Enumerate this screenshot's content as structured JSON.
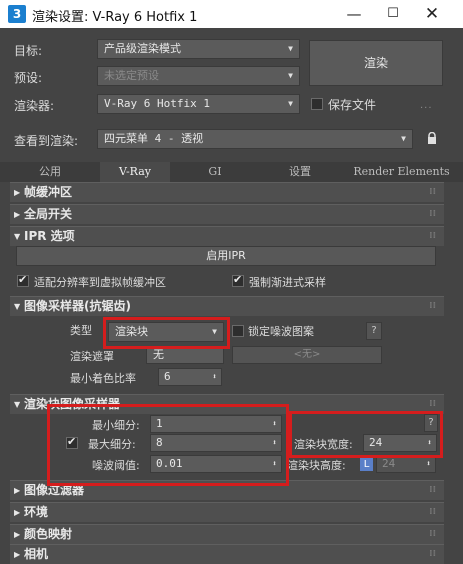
{
  "window": {
    "title": "渲染设置: V-Ray 6 Hotfix 1",
    "icon_text": "3",
    "minimize_icon": "minimize-icon",
    "maximize_icon": "maximize-icon",
    "close_icon": "close-icon"
  },
  "header": {
    "target_label": "目标:",
    "target_value": "产品级渲染模式",
    "preset_label": "预设:",
    "preset_value": "未选定预设",
    "renderer_label": "渲染器:",
    "renderer_value": "V-Ray 6 Hotfix 1",
    "save_file_label": "保存文件",
    "save_file_checked": false,
    "dots": "...",
    "view_label": "查看到渲染:",
    "view_value": "四元菜单 4 - 透视",
    "render_button": "渲染"
  },
  "tabs": [
    {
      "label": "公用",
      "active": false
    },
    {
      "label": "V-Ray",
      "active": true
    },
    {
      "label": "GI",
      "active": false
    },
    {
      "label": "设置",
      "active": false
    },
    {
      "label": "Render Elements",
      "active": false
    }
  ],
  "rollouts": {
    "frame_buffer": "帧缓冲区",
    "global_switches": "全局开关",
    "ipr_options": "IPR 选项",
    "image_sampler": "图像采样器(抗锯齿)",
    "bucket_sampler": "渲染块图像采样器",
    "image_filter": "图像过滤器",
    "environment": "环境",
    "color_mapping": "颜色映射",
    "camera": "相机",
    "grip": "⁞⁞"
  },
  "ipr": {
    "start_button": "启用IPR",
    "fit_resolution_label": "适配分辨率到虚拟帧缓冲区",
    "fit_resolution_checked": true,
    "force_progressive_label": "强制渐进式采样",
    "force_progressive_checked": true
  },
  "image_sampler": {
    "type_label": "类型",
    "type_value": "渲染块",
    "lock_noise_label": "锁定噪波图案",
    "lock_noise_checked": false,
    "help_button": "?",
    "render_mask_label": "渲染遮罩",
    "render_mask_value": "无",
    "render_mask_none": "<无>",
    "min_shading_label": "最小着色比率",
    "min_shading_value": "6"
  },
  "bucket_sampler": {
    "min_subdivs_label": "最小细分:",
    "min_subdivs_value": "1",
    "max_subdivs_label": "最大细分:",
    "max_subdivs_value": "8",
    "max_subdivs_checked": true,
    "noise_threshold_label": "噪波阈值:",
    "noise_threshold_value": "0.01",
    "help_button": "?",
    "bucket_width_label": "渲染块宽度:",
    "bucket_width_value": "24",
    "bucket_height_label": "渲染块高度:",
    "bucket_height_lock": "L",
    "bucket_height_value": "24"
  },
  "colors": {
    "highlight_red": "#d51d1d",
    "panel_bg": "#444444",
    "accent_blue": "#5a7fc8"
  }
}
